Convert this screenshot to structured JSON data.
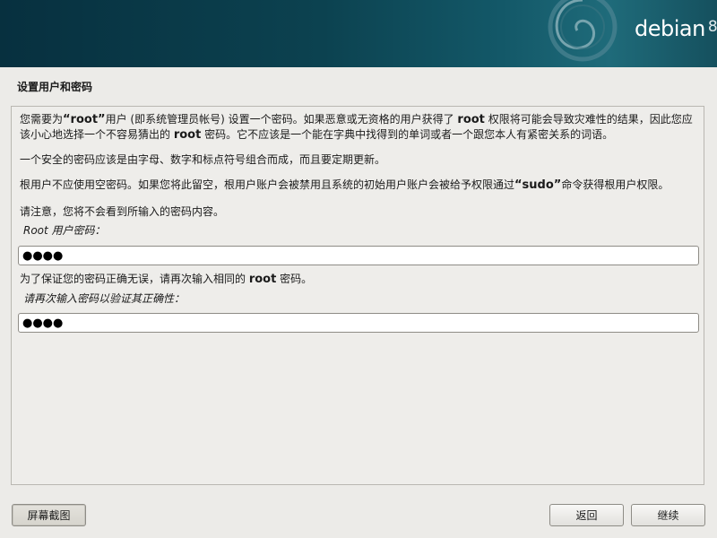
{
  "header": {
    "brand": "debian",
    "version": "8"
  },
  "page_title": "设置用户和密码",
  "intro": {
    "p1_a": "您需要为",
    "p1_b": "“root”",
    "p1_c": "用户 (即系统管理员帐号) 设置一个密码。如果恶意或无资格的用户获得了 ",
    "p1_d": "root",
    "p1_e": " 权限将可能会导致灾难性的结果，因此您应该小心地选择一个不容易猜出的 ",
    "p1_f": "root",
    "p1_g": " 密码。它不应该是一个能在字典中找得到的单词或者一个跟您本人有紧密关系的词语。",
    "p2": "一个安全的密码应该是由字母、数字和标点符号组合而成，而且要定期更新。",
    "p3_a": "根用户不应使用空密码。如果您将此留空，根用户账户会被禁用且系统的初始用户账户会被给予权限通过",
    "p3_b": "“sudo”",
    "p3_c": "命令获得根用户权限。",
    "p4": "请注意，您将不会看到所输入的密码内容。"
  },
  "root_password": {
    "label": "Root 用户密码：",
    "value": "●●●●"
  },
  "verify": {
    "note_a": "为了保证您的密码正确无误，请再次输入相同的 ",
    "note_b": "root",
    "note_c": " 密码。",
    "label": "请再次输入密码以验证其正确性：",
    "value": "●●●●"
  },
  "buttons": {
    "screenshot": "屏幕截图",
    "back": "返回",
    "continue": "继续"
  }
}
